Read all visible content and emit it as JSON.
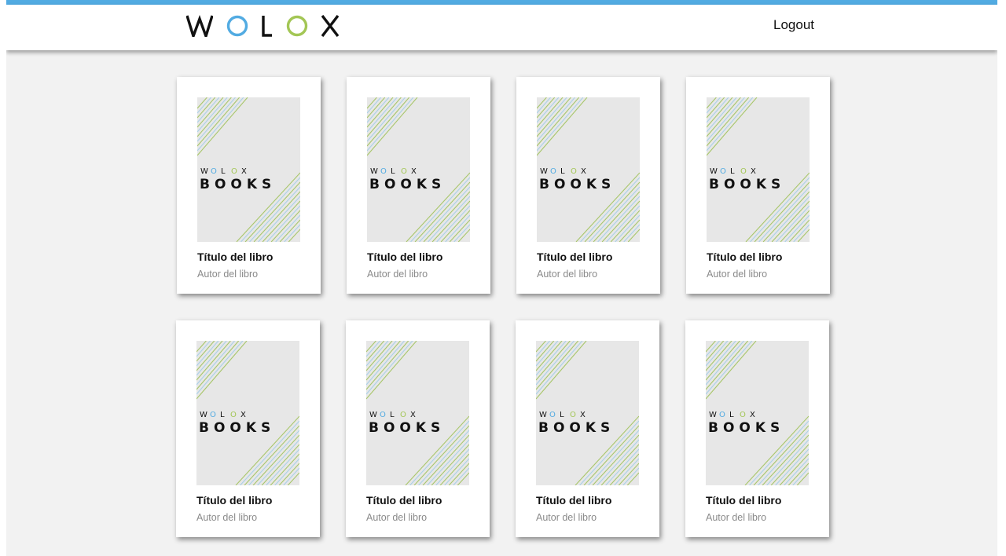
{
  "header": {
    "logo_letters": [
      "W",
      "O",
      "L",
      "O",
      "X"
    ],
    "logout_label": "Logout",
    "accent_color": "#52abe2",
    "brand_green": "#a3c655"
  },
  "books": [
    {
      "title": "Título del libro",
      "author": "Autor del libro",
      "cover": {
        "brand": "WOLOX",
        "name": "BOOKS"
      }
    },
    {
      "title": "Título del libro",
      "author": "Autor del libro",
      "cover": {
        "brand": "WOLOX",
        "name": "BOOKS"
      }
    },
    {
      "title": "Título del libro",
      "author": "Autor del libro",
      "cover": {
        "brand": "WOLOX",
        "name": "BOOKS"
      }
    },
    {
      "title": "Título del libro",
      "author": "Autor del libro",
      "cover": {
        "brand": "WOLOX",
        "name": "BOOKS"
      }
    },
    {
      "title": "Título del libro",
      "author": "Autor del libro",
      "cover": {
        "brand": "WOLOX",
        "name": "BOOKS"
      }
    },
    {
      "title": "Título del libro",
      "author": "Autor del libro",
      "cover": {
        "brand": "WOLOX",
        "name": "BOOKS"
      }
    },
    {
      "title": "Título del libro",
      "author": "Autor del libro",
      "cover": {
        "brand": "WOLOX",
        "name": "BOOKS"
      }
    },
    {
      "title": "Título del libro",
      "author": "Autor del libro",
      "cover": {
        "brand": "WOLOX",
        "name": "BOOKS"
      }
    }
  ]
}
